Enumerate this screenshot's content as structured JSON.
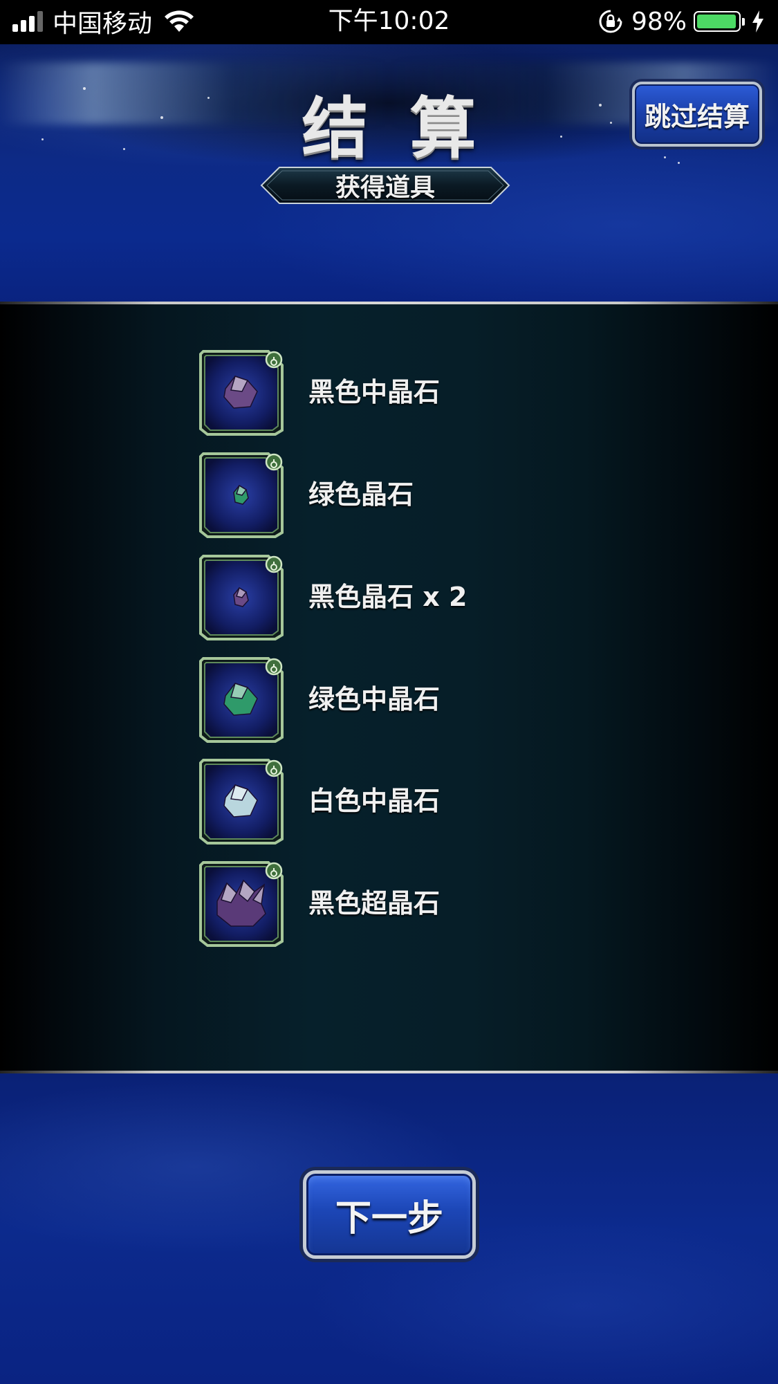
{
  "status_bar": {
    "carrier": "中国移动",
    "time": "下午10:02",
    "battery_percent": "98%",
    "battery_level": 0.98,
    "icons": [
      "signal-icon",
      "wifi-icon",
      "rotation-lock-icon",
      "battery-icon",
      "charging-bolt-icon"
    ]
  },
  "header": {
    "title": "结算",
    "skip_button_label": "跳过结算",
    "subtitle": "获得道具"
  },
  "items": [
    {
      "name": "黑色中晶石",
      "icon": "black-medium-crystal-icon",
      "color": "#6b4a86"
    },
    {
      "name": "绿色晶石",
      "icon": "green-crystal-icon",
      "color": "#2f9a6a"
    },
    {
      "name": "黑色晶石 x 2",
      "icon": "black-crystal-icon",
      "color": "#6b4a86"
    },
    {
      "name": "绿色中晶石",
      "icon": "green-medium-crystal-icon",
      "color": "#2f9a6a"
    },
    {
      "name": "白色中晶石",
      "icon": "white-medium-crystal-icon",
      "color": "#b9d6de"
    },
    {
      "name": "黑色超晶石",
      "icon": "black-super-crystal-icon",
      "color": "#5a3a78"
    }
  ],
  "footer": {
    "next_button_label": "下一步"
  },
  "colors": {
    "background_blue": "#0c2a8d",
    "panel_dark": "#06202b",
    "button_blue": "#1c46b6",
    "frame_green": "#7fb07a",
    "battery_green": "#4cd964"
  }
}
